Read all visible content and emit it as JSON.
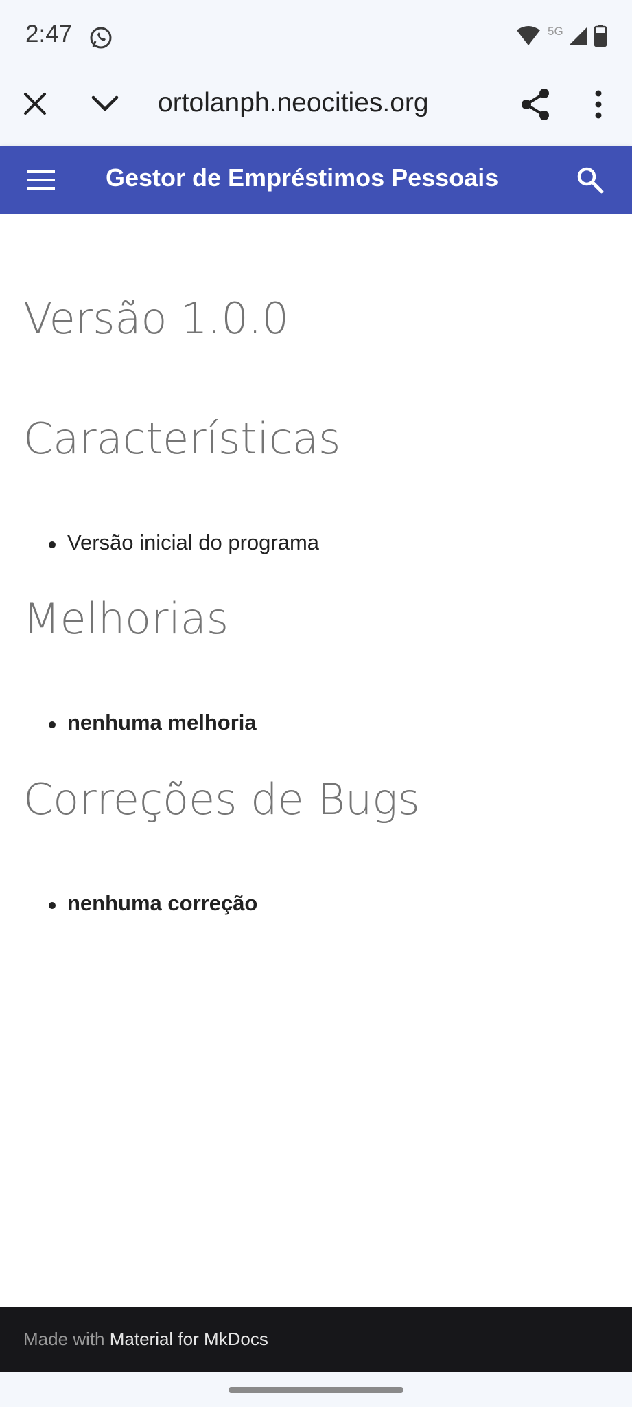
{
  "status_bar": {
    "time": "2:47",
    "icons": [
      "whatsapp-icon",
      "wifi-icon",
      "5g-icon",
      "signal-icon",
      "battery-icon"
    ],
    "network_label": "5G"
  },
  "browser": {
    "url": "ortolanph.neocities.org",
    "icons": [
      "close-icon",
      "chevron-down-icon",
      "share-icon",
      "more-vert-icon"
    ]
  },
  "header": {
    "title": "Gestor de Empréstimos Pessoais",
    "menu_icon": "menu-icon",
    "search_icon": "search-icon",
    "background": "#4051b5"
  },
  "content": {
    "version_title": "Versão 1.0.0",
    "sections": [
      {
        "title": "Características",
        "items": [
          "Versão inicial do programa"
        ]
      },
      {
        "title": "Melhorias",
        "items": [
          "nenhuma melhoria"
        ]
      },
      {
        "title": "Correções de Bugs",
        "items": [
          "nenhuma correção"
        ]
      }
    ]
  },
  "footer": {
    "prefix": "Made with",
    "link": "Material for MkDocs"
  }
}
